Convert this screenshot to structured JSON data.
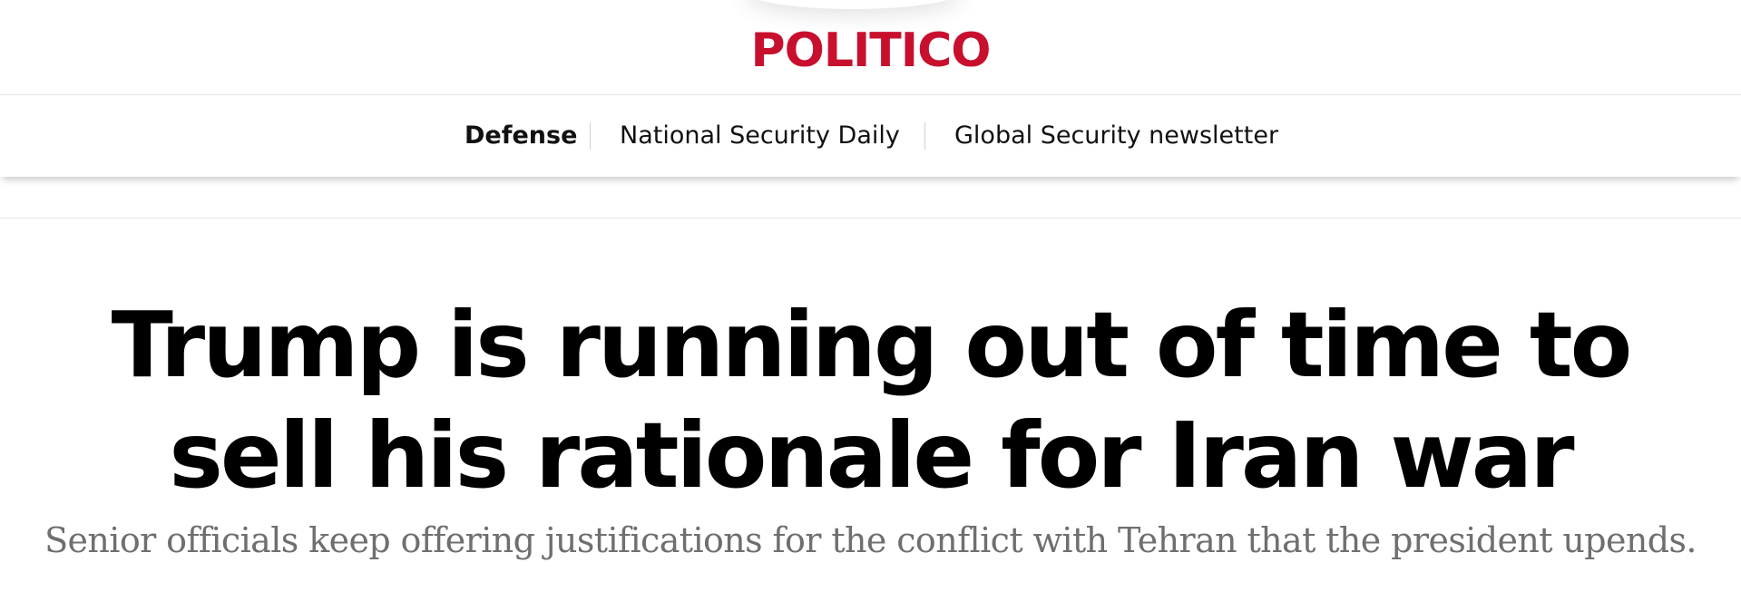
{
  "header": {
    "logo_text": "POLITICO",
    "brand_color": "#c8102e"
  },
  "nav": {
    "items": [
      {
        "label": "Defense",
        "active": true
      },
      {
        "label": "National Security Daily",
        "active": false
      },
      {
        "label": "Global Security newsletter",
        "active": false
      }
    ]
  },
  "article": {
    "headline": "Trump is running out of time to sell his rationale for Iran war",
    "dek": "Senior officials keep offering justifications for the conflict with Tehran that the president upends."
  }
}
